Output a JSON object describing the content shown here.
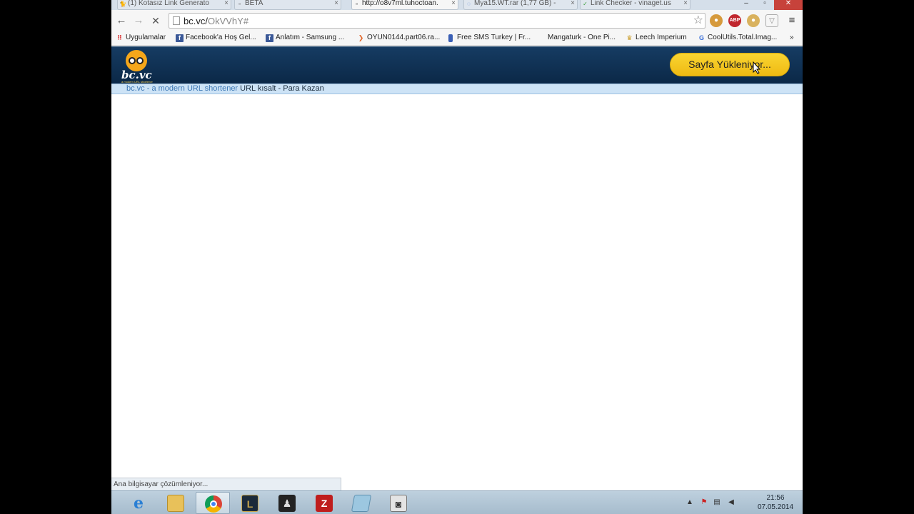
{
  "tabs": [
    {
      "title": "(1) Kotasız Link Generato",
      "icon": "github-icon",
      "active": false
    },
    {
      "title": "BETA",
      "icon": "document-icon",
      "active": false
    },
    {
      "title": "http://o8v7ml.tuhoctoan.",
      "icon": "document-icon",
      "active": true
    },
    {
      "title": "Mya15.WT.rar (1,77 GB) -",
      "icon": "loading-icon",
      "active": false
    },
    {
      "title": "Link Checker - vinaget.us",
      "icon": "check-icon",
      "active": false
    }
  ],
  "toolbar": {
    "url_host": "bc.vc/",
    "url_path": "OkVVhY#"
  },
  "bookmarks": [
    {
      "label": "Uygulamalar",
      "icon": "apps-icon"
    },
    {
      "label": "Facebook'a Hoş Gel...",
      "icon": "facebook-icon"
    },
    {
      "label": "Anlatım - Samsung ...",
      "icon": "facebook-icon"
    },
    {
      "label": "OYUN0144.part06.ra...",
      "icon": "download-icon"
    },
    {
      "label": "Free SMS Turkey | Fr...",
      "icon": "phone-icon"
    },
    {
      "label": "Mangaturk - One Pi...",
      "icon": ""
    },
    {
      "label": "Leech Imperium",
      "icon": "crown-icon"
    },
    {
      "label": "CoolUtils.Total.Imag...",
      "icon": "google-icon"
    }
  ],
  "page": {
    "loading_button": "Sayfa Yükleniyor...",
    "subbar_link": "bc.vc - a modern URL shortener",
    "subbar_text": " URL kısalt - Para Kazan",
    "logo_text": "bc.vc",
    "logo_tagline": "a modern URL shortener"
  },
  "status_text": "Ana bilgisayar çözümleniyor...",
  "taskbar": {
    "apps": [
      "internet-explorer-icon",
      "file-explorer-icon",
      "chrome-icon",
      "league-of-legends-icon",
      "game-icon",
      "filezilla-icon",
      "notepad-icon",
      "camera-icon"
    ],
    "time": "21:56",
    "date": "07.05.2014"
  },
  "colors": {
    "header": "#0b2847",
    "button": "#f9d532",
    "subbar": "#cde3f6",
    "link": "#3d78b5"
  }
}
